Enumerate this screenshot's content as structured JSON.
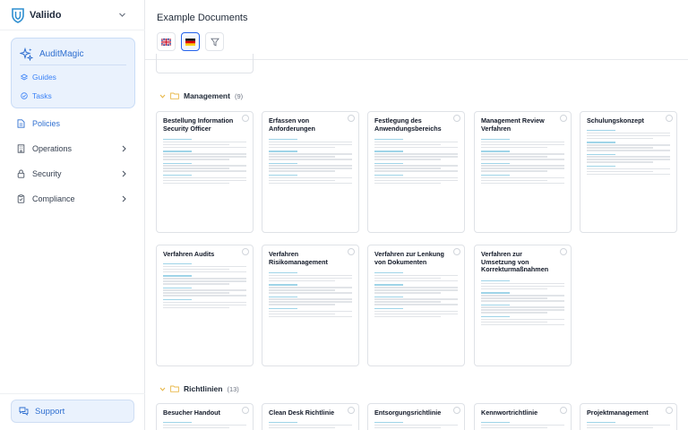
{
  "brand": {
    "name": "Valiido"
  },
  "ai": {
    "title": "AuditMagic",
    "items": [
      {
        "label": "Guides",
        "icon": "layers-icon"
      },
      {
        "label": "Tasks",
        "icon": "check-circle-icon"
      }
    ]
  },
  "nav": [
    {
      "label": "Policies",
      "icon": "document-icon",
      "active": true
    },
    {
      "label": "Operations",
      "icon": "building-icon"
    },
    {
      "label": "Security",
      "icon": "lock-icon"
    },
    {
      "label": "Compliance",
      "icon": "clipboard-icon"
    }
  ],
  "support": {
    "label": "Support"
  },
  "page": {
    "title": "Example Documents"
  },
  "toolbar": {
    "languages": [
      "en",
      "de"
    ],
    "selected_language": "de"
  },
  "groups": [
    {
      "name": "Management",
      "count": "(9)",
      "docs": [
        "Bestellung Information Security Officer",
        "Erfassen von Anforderungen",
        "Festlegung des Anwendungsbereichs",
        "Management Review Verfahren",
        "Schulungskonzept",
        "Verfahren Audits",
        "Verfahren Risikomanagement",
        "Verfahren zur Lenkung von Dokumenten",
        "Verfahren zur Umsetzung von Korrekturmaßnahmen"
      ]
    },
    {
      "name": "Richtlinien",
      "count": "(13)",
      "docs": [
        "Besucher Handout",
        "Clean Desk Richtlinie",
        "Entsorgungsrichtlinie",
        "Kennwortrichtlinie",
        "Projektmanagement"
      ]
    }
  ],
  "colors": {
    "accent": "#2f6fd0",
    "accent_bg": "#eaf2fd",
    "preview_highlight": "#9fd4e8",
    "folder": "#e8b84a"
  }
}
